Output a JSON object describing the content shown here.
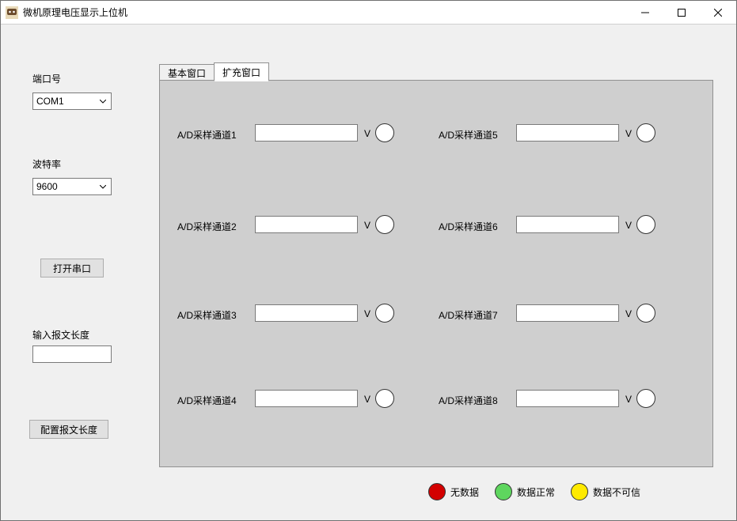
{
  "window": {
    "title": "微机原理电压显示上位机"
  },
  "sidebar": {
    "port_label": "端口号",
    "port_value": "COM1",
    "baud_label": "波特率",
    "baud_value": "9600",
    "open_port_btn": "打开串口",
    "msglen_label": "输入报文长度",
    "msglen_value": "",
    "config_msglen_btn": "配置报文长度"
  },
  "tabs": {
    "basic": "基本窗口",
    "extended": "扩充窗口",
    "active": "extended"
  },
  "channels": [
    {
      "label": "A/D采样通道1",
      "value": "",
      "unit": "V"
    },
    {
      "label": "A/D采样通道2",
      "value": "",
      "unit": "V"
    },
    {
      "label": "A/D采样通道3",
      "value": "",
      "unit": "V"
    },
    {
      "label": "A/D采样通道4",
      "value": "",
      "unit": "V"
    },
    {
      "label": "A/D采样通道5",
      "value": "",
      "unit": "V"
    },
    {
      "label": "A/D采样通道6",
      "value": "",
      "unit": "V"
    },
    {
      "label": "A/D采样通道7",
      "value": "",
      "unit": "V"
    },
    {
      "label": "A/D采样通道8",
      "value": "",
      "unit": "V"
    }
  ],
  "legend": {
    "no_data": "无数据",
    "ok": "数据正常",
    "untrusted": "数据不可信"
  }
}
